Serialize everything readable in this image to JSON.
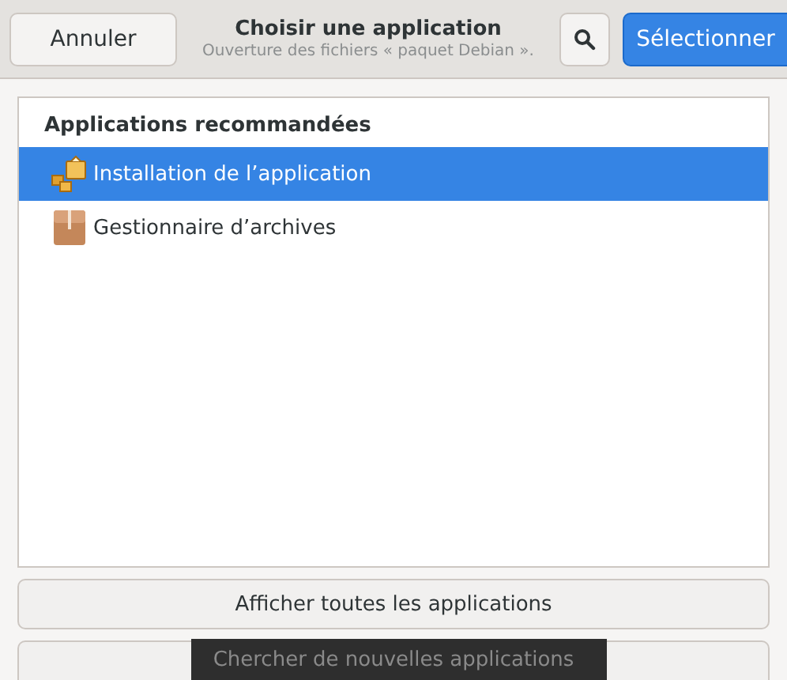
{
  "header": {
    "cancel_button": "Annuler",
    "title": "Choisir une application",
    "subtitle": "Ouverture des fichiers « paquet Debian ».",
    "select_button": "Sélectionner"
  },
  "app_list": {
    "heading": "Applications recommandées",
    "items": [
      {
        "label": "Installation de l’application",
        "kind": "installer",
        "selected": true
      },
      {
        "label": "Gestionnaire d’archives",
        "kind": "archive",
        "selected": false
      }
    ]
  },
  "buttons": [
    "Afficher toutes les applications",
    "Chercher de nouvelles applications"
  ]
}
